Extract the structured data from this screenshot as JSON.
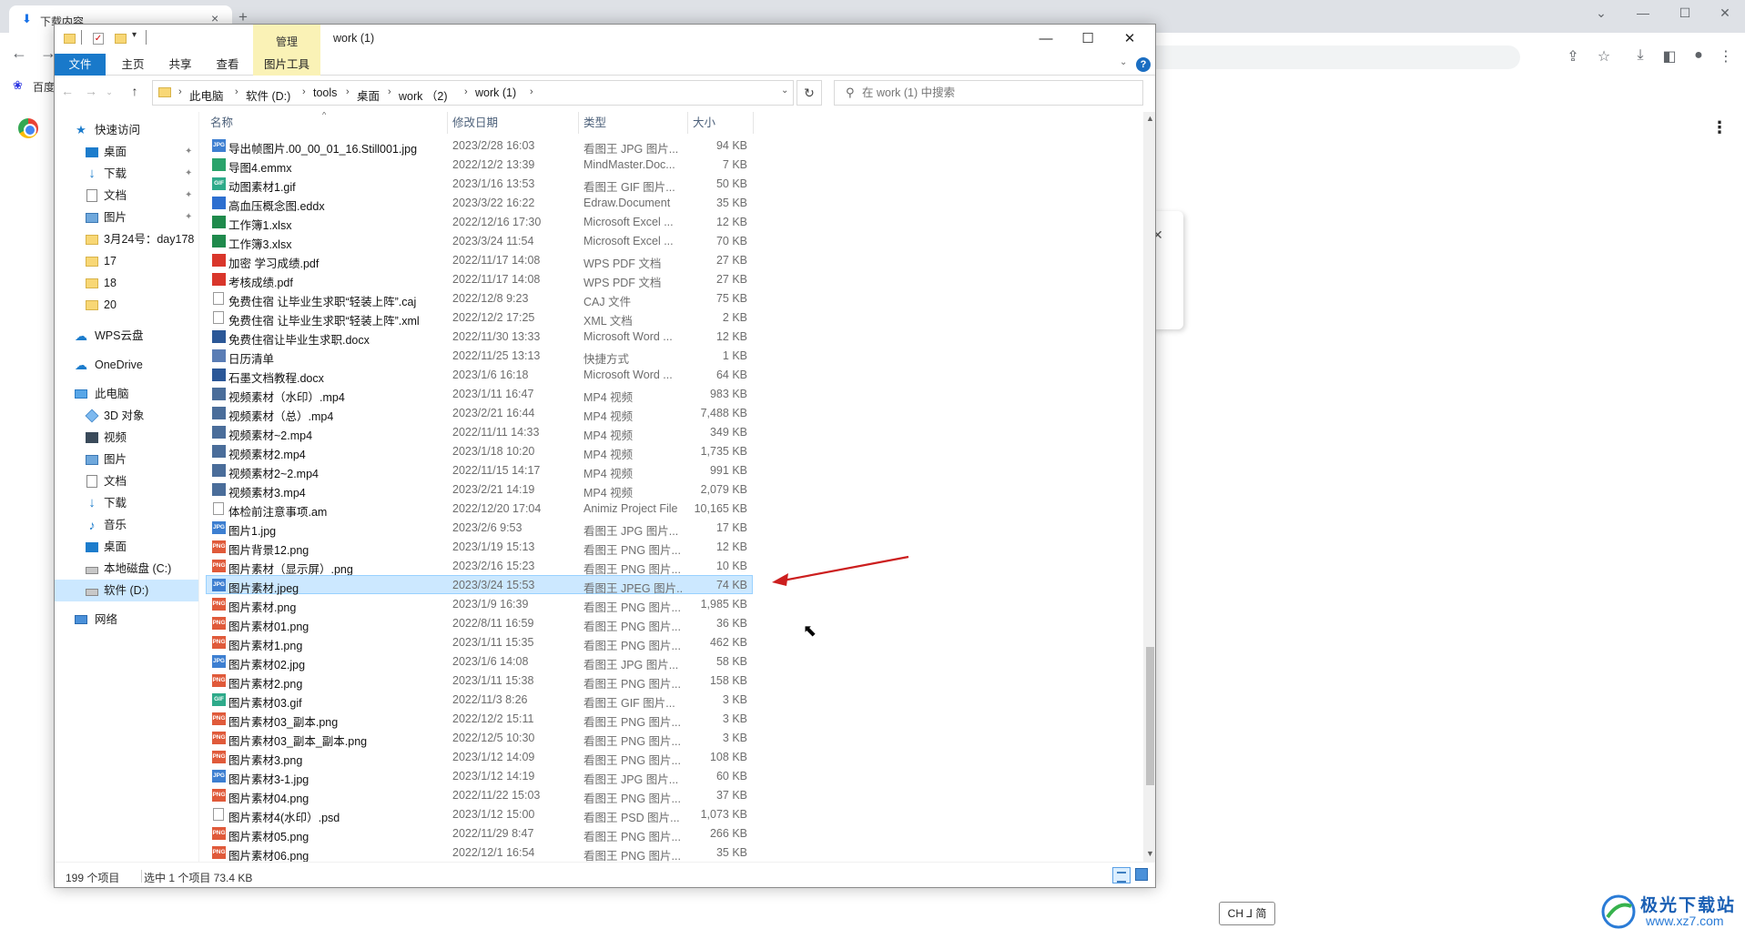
{
  "browser": {
    "tab_title": "下载内容",
    "bookmark_label": "百度"
  },
  "window": {
    "title": "work (1)",
    "context_group": "管理",
    "minimize": "—",
    "maximize": "☐",
    "close": "✕"
  },
  "ribbon": {
    "tabs": [
      "文件",
      "主页",
      "共享",
      "查看",
      "图片工具"
    ]
  },
  "address": {
    "crumbs": [
      "此电脑",
      "软件 (D:)",
      "tools",
      "桌面",
      "work （2)",
      "work (1)"
    ]
  },
  "search": {
    "placeholder": "在 work (1) 中搜索"
  },
  "nav": {
    "quick_access": "快速访问",
    "items": [
      {
        "label": "桌面",
        "icon": "desktop-icon",
        "pinned": true
      },
      {
        "label": "下载",
        "icon": "download-icon",
        "pinned": true
      },
      {
        "label": "文档",
        "icon": "document-icon",
        "pinned": true
      },
      {
        "label": "图片",
        "icon": "picture-icon",
        "pinned": true
      },
      {
        "label": "3月24号：day178",
        "icon": "folder-icon"
      },
      {
        "label": "17",
        "icon": "folder-icon"
      },
      {
        "label": "18",
        "icon": "folder-icon"
      },
      {
        "label": "20",
        "icon": "folder-icon"
      }
    ],
    "wps_cloud": "WPS云盘",
    "onedrive": "OneDrive",
    "this_pc": "此电脑",
    "pc_items": [
      {
        "label": "3D 对象",
        "icon": "3d-objects-icon"
      },
      {
        "label": "视频",
        "icon": "video-icon"
      },
      {
        "label": "图片",
        "icon": "picture-icon"
      },
      {
        "label": "文档",
        "icon": "document-icon"
      },
      {
        "label": "下载",
        "icon": "download-icon"
      },
      {
        "label": "音乐",
        "icon": "music-icon"
      },
      {
        "label": "桌面",
        "icon": "desktop-icon"
      },
      {
        "label": "本地磁盘 (C:)",
        "icon": "drive-icon"
      },
      {
        "label": "软件 (D:)",
        "icon": "drive-icon",
        "selected": true
      }
    ],
    "network": "网络"
  },
  "columns": {
    "name": "名称",
    "date": "修改日期",
    "type": "类型",
    "size": "大小"
  },
  "files": [
    {
      "name": "导出帧图片.00_00_01_16.Still001.jpg",
      "date": "2023/2/28 16:03",
      "type": "看图王 JPG 图片...",
      "size": "94 KB",
      "icon": "jpg",
      "color": "#3d7fd1"
    },
    {
      "name": "导图4.emmx",
      "date": "2022/12/2 13:39",
      "type": "MindMaster.Doc...",
      "size": "7 KB",
      "icon": "emmx",
      "color": "#2aa36b"
    },
    {
      "name": "动图素材1.gif",
      "date": "2023/1/16 13:53",
      "type": "看图王 GIF 图片...",
      "size": "50 KB",
      "icon": "gif",
      "color": "#2eaa8a"
    },
    {
      "name": "高血压概念图.eddx",
      "date": "2023/3/22 16:22",
      "type": "Edraw.Document",
      "size": "35 KB",
      "icon": "eddx",
      "color": "#2d6fd0"
    },
    {
      "name": "工作簿1.xlsx",
      "date": "2022/12/16 17:30",
      "type": "Microsoft Excel ...",
      "size": "12 KB",
      "icon": "xls",
      "color": "#1f8a4c"
    },
    {
      "name": "工作簿3.xlsx",
      "date": "2023/3/24 11:54",
      "type": "Microsoft Excel ...",
      "size": "70 KB",
      "icon": "xls",
      "color": "#1f8a4c"
    },
    {
      "name": "加密 学习成绩.pdf",
      "date": "2022/11/17 14:08",
      "type": "WPS PDF 文档",
      "size": "27 KB",
      "icon": "pdf",
      "color": "#d9362b"
    },
    {
      "name": "考核成绩.pdf",
      "date": "2022/11/17 14:08",
      "type": "WPS PDF 文档",
      "size": "27 KB",
      "icon": "pdf",
      "color": "#d9362b"
    },
    {
      "name": "免费住宿  让毕业生求职“轻装上阵”.caj",
      "date": "2022/12/8 9:23",
      "type": "CAJ 文件",
      "size": "75 KB",
      "icon": "blank",
      "color": "#ffffff"
    },
    {
      "name": "免费住宿  让毕业生求职“轻装上阵”.xml",
      "date": "2022/12/2 17:25",
      "type": "XML 文档",
      "size": "2 KB",
      "icon": "blank",
      "color": "#ffffff"
    },
    {
      "name": "免费住宿让毕业生求职.docx",
      "date": "2022/11/30 13:33",
      "type": "Microsoft Word ...",
      "size": "12 KB",
      "icon": "doc",
      "color": "#2b5797"
    },
    {
      "name": "日历清单",
      "date": "2022/11/25 13:13",
      "type": "快捷方式",
      "size": "1 KB",
      "icon": "lnk",
      "color": "#5a7db5"
    },
    {
      "name": "石墨文档教程.docx",
      "date": "2023/1/6 16:18",
      "type": "Microsoft Word ...",
      "size": "64 KB",
      "icon": "doc",
      "color": "#2b5797"
    },
    {
      "name": "视频素材（水印）.mp4",
      "date": "2023/1/11 16:47",
      "type": "MP4 视频",
      "size": "983 KB",
      "icon": "mp4",
      "color": "#4a6d9a"
    },
    {
      "name": "视频素材（总）.mp4",
      "date": "2023/2/21 16:44",
      "type": "MP4 视频",
      "size": "7,488 KB",
      "icon": "mp4",
      "color": "#4a6d9a"
    },
    {
      "name": "视频素材~2.mp4",
      "date": "2022/11/11 14:33",
      "type": "MP4 视频",
      "size": "349 KB",
      "icon": "mp4",
      "color": "#4a6d9a"
    },
    {
      "name": "视频素材2.mp4",
      "date": "2023/1/18 10:20",
      "type": "MP4 视频",
      "size": "1,735 KB",
      "icon": "mp4",
      "color": "#4a6d9a"
    },
    {
      "name": "视频素材2~2.mp4",
      "date": "2022/11/15 14:17",
      "type": "MP4 视频",
      "size": "991 KB",
      "icon": "mp4",
      "color": "#4a6d9a"
    },
    {
      "name": "视频素材3.mp4",
      "date": "2023/2/21 14:19",
      "type": "MP4 视频",
      "size": "2,079 KB",
      "icon": "mp4",
      "color": "#4a6d9a"
    },
    {
      "name": "体检前注意事项.am",
      "date": "2022/12/20 17:04",
      "type": "Animiz Project File",
      "size": "10,165 KB",
      "icon": "blank",
      "color": "#ffffff"
    },
    {
      "name": "图片1.jpg",
      "date": "2023/2/6 9:53",
      "type": "看图王 JPG 图片...",
      "size": "17 KB",
      "icon": "jpg",
      "color": "#3d7fd1"
    },
    {
      "name": "图片背景12.png",
      "date": "2023/1/19 15:13",
      "type": "看图王 PNG 图片...",
      "size": "12 KB",
      "icon": "png",
      "color": "#e05a3a"
    },
    {
      "name": "图片素材（显示屏）.png",
      "date": "2023/2/16 15:23",
      "type": "看图王 PNG 图片...",
      "size": "10 KB",
      "icon": "png",
      "color": "#e05a3a"
    },
    {
      "name": "图片素材.jpeg",
      "date": "2023/3/24 15:53",
      "type": "看图王 JPEG 图片...",
      "size": "74 KB",
      "icon": "jpg",
      "color": "#3d7fd1",
      "selected": true
    },
    {
      "name": "图片素材.png",
      "date": "2023/1/9 16:39",
      "type": "看图王 PNG 图片...",
      "size": "1,985 KB",
      "icon": "png",
      "color": "#e05a3a"
    },
    {
      "name": "图片素材01.png",
      "date": "2022/8/11 16:59",
      "type": "看图王 PNG 图片...",
      "size": "36 KB",
      "icon": "png",
      "color": "#e05a3a"
    },
    {
      "name": "图片素材1.png",
      "date": "2023/1/11 15:35",
      "type": "看图王 PNG 图片...",
      "size": "462 KB",
      "icon": "png",
      "color": "#e05a3a"
    },
    {
      "name": "图片素材02.jpg",
      "date": "2023/1/6 14:08",
      "type": "看图王 JPG 图片...",
      "size": "58 KB",
      "icon": "jpg",
      "color": "#3d7fd1"
    },
    {
      "name": "图片素材2.png",
      "date": "2023/1/11 15:38",
      "type": "看图王 PNG 图片...",
      "size": "158 KB",
      "icon": "png",
      "color": "#e05a3a"
    },
    {
      "name": "图片素材03.gif",
      "date": "2022/11/3 8:26",
      "type": "看图王 GIF 图片...",
      "size": "3 KB",
      "icon": "gif",
      "color": "#2eaa8a"
    },
    {
      "name": "图片素材03_副本.png",
      "date": "2022/12/2 15:11",
      "type": "看图王 PNG 图片...",
      "size": "3 KB",
      "icon": "png",
      "color": "#e05a3a"
    },
    {
      "name": "图片素材03_副本_副本.png",
      "date": "2022/12/5 10:30",
      "type": "看图王 PNG 图片...",
      "size": "3 KB",
      "icon": "png",
      "color": "#e05a3a"
    },
    {
      "name": "图片素材3.png",
      "date": "2023/1/12 14:09",
      "type": "看图王 PNG 图片...",
      "size": "108 KB",
      "icon": "png",
      "color": "#e05a3a"
    },
    {
      "name": "图片素材3-1.jpg",
      "date": "2023/1/12 14:19",
      "type": "看图王 JPG 图片...",
      "size": "60 KB",
      "icon": "jpg",
      "color": "#3d7fd1"
    },
    {
      "name": "图片素材04.png",
      "date": "2022/11/22 15:03",
      "type": "看图王 PNG 图片...",
      "size": "37 KB",
      "icon": "png",
      "color": "#e05a3a"
    },
    {
      "name": "图片素材4(水印）.psd",
      "date": "2023/1/12 15:00",
      "type": "看图王 PSD 图片...",
      "size": "1,073 KB",
      "icon": "blank",
      "color": "#ffffff"
    },
    {
      "name": "图片素材05.png",
      "date": "2022/11/29 8:47",
      "type": "看图王 PNG 图片...",
      "size": "266 KB",
      "icon": "png",
      "color": "#e05a3a"
    },
    {
      "name": "图片素材06.png",
      "date": "2022/12/1 16:54",
      "type": "看图王 PNG 图片...",
      "size": "35 KB",
      "icon": "png",
      "color": "#e05a3a"
    }
  ],
  "status": {
    "item_count": "199 个项目",
    "selection": "选中 1 个项目  73.4 KB"
  },
  "ime": "CH ⅃ 简",
  "watermark": {
    "title": "极光下载站",
    "url": "www.xz7.com"
  },
  "accent_color": "#1979ca",
  "arrow_color": "#cc1f1f"
}
